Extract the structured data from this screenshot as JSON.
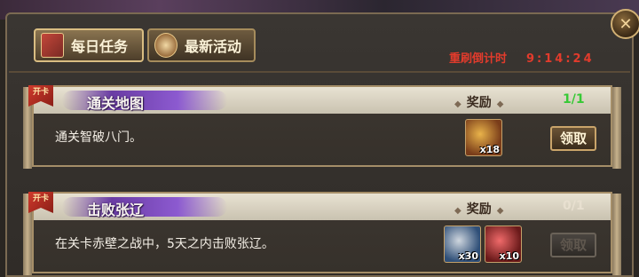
{
  "tabs": [
    {
      "label": "每日任务",
      "active": true,
      "icon": "scroll-icon"
    },
    {
      "label": "最新活动",
      "active": false,
      "icon": "event-icon"
    }
  ],
  "countdown": {
    "label": "重刷倒计时",
    "time": "9:14:24"
  },
  "ribbon_text": "开卡",
  "tasks": [
    {
      "title": "通关地图",
      "reward_label": "奖励",
      "progress": "1/1",
      "description": "通关智破八门。",
      "rewards": [
        {
          "icon": "gold-ingot-icon",
          "qty": "x18"
        }
      ],
      "button": "领取",
      "claimable": true
    },
    {
      "title": "击败张辽",
      "reward_label": "奖励",
      "progress": "0/1",
      "description": "在关卡赤壁之战中，5天之内击败张辽。",
      "rewards": [
        {
          "icon": "silver-ore-icon",
          "qty": "x30"
        },
        {
          "icon": "red-gift-icon",
          "qty": "x10"
        }
      ],
      "button": "领取",
      "claimable": false
    }
  ],
  "colors": {
    "countdown": "#e23b2c",
    "progress_done": "#37c935",
    "panel_border": "#7b6a52"
  }
}
